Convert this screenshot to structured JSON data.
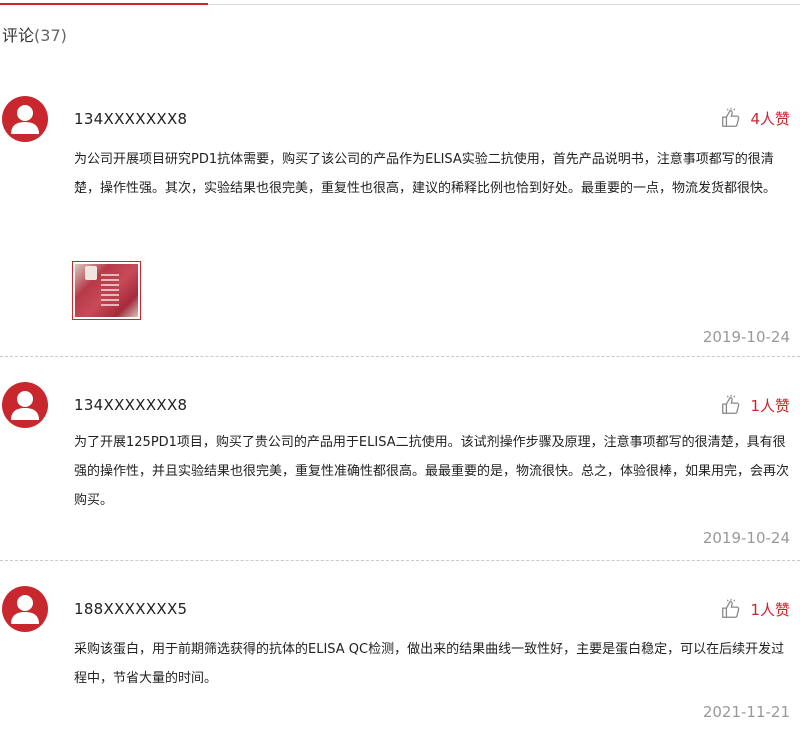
{
  "header": {
    "title": "评论",
    "count": "(37)"
  },
  "reviews": [
    {
      "user": "134XXXXXXX8",
      "likes": "4人赞",
      "text": "为公司开展项目研究PD1抗体需要，购买了该公司的产品作为ELISA实验二抗使用，首先产品说明书，注意事项都写的很清楚，操作性强。其次，实验结果也很完美，重复性也很高，建议的稀释比例也恰到好处。最重要的一点，物流发货都很快。",
      "has_image": true,
      "date": "2019-10-24"
    },
    {
      "user": "134XXXXXXX8",
      "likes": "1人赞",
      "text": "为了开展125PD1项目，购买了贵公司的产品用于ELISA二抗使用。该试剂操作步骤及原理，注意事项都写的很清楚，具有很强的操作性，并且实验结果也很完美，重复性准确性都很高。最最重要的是，物流很快。总之，体验很棒，如果用完，会再次购买。",
      "has_image": false,
      "date": "2019-10-24"
    },
    {
      "user": "188XXXXXXX5",
      "likes": "1人赞",
      "text": "采购该蛋白，用于前期筛选获得的抗体的ELISA QC检测，做出来的结果曲线一致性好，主要是蛋白稳定，可以在后续开发过程中，节省大量的时间。",
      "has_image": false,
      "date": "2021-11-21"
    }
  ],
  "colors": {
    "accent": "#c8282d",
    "date": "#999999",
    "divider": "#c9c9c9"
  }
}
